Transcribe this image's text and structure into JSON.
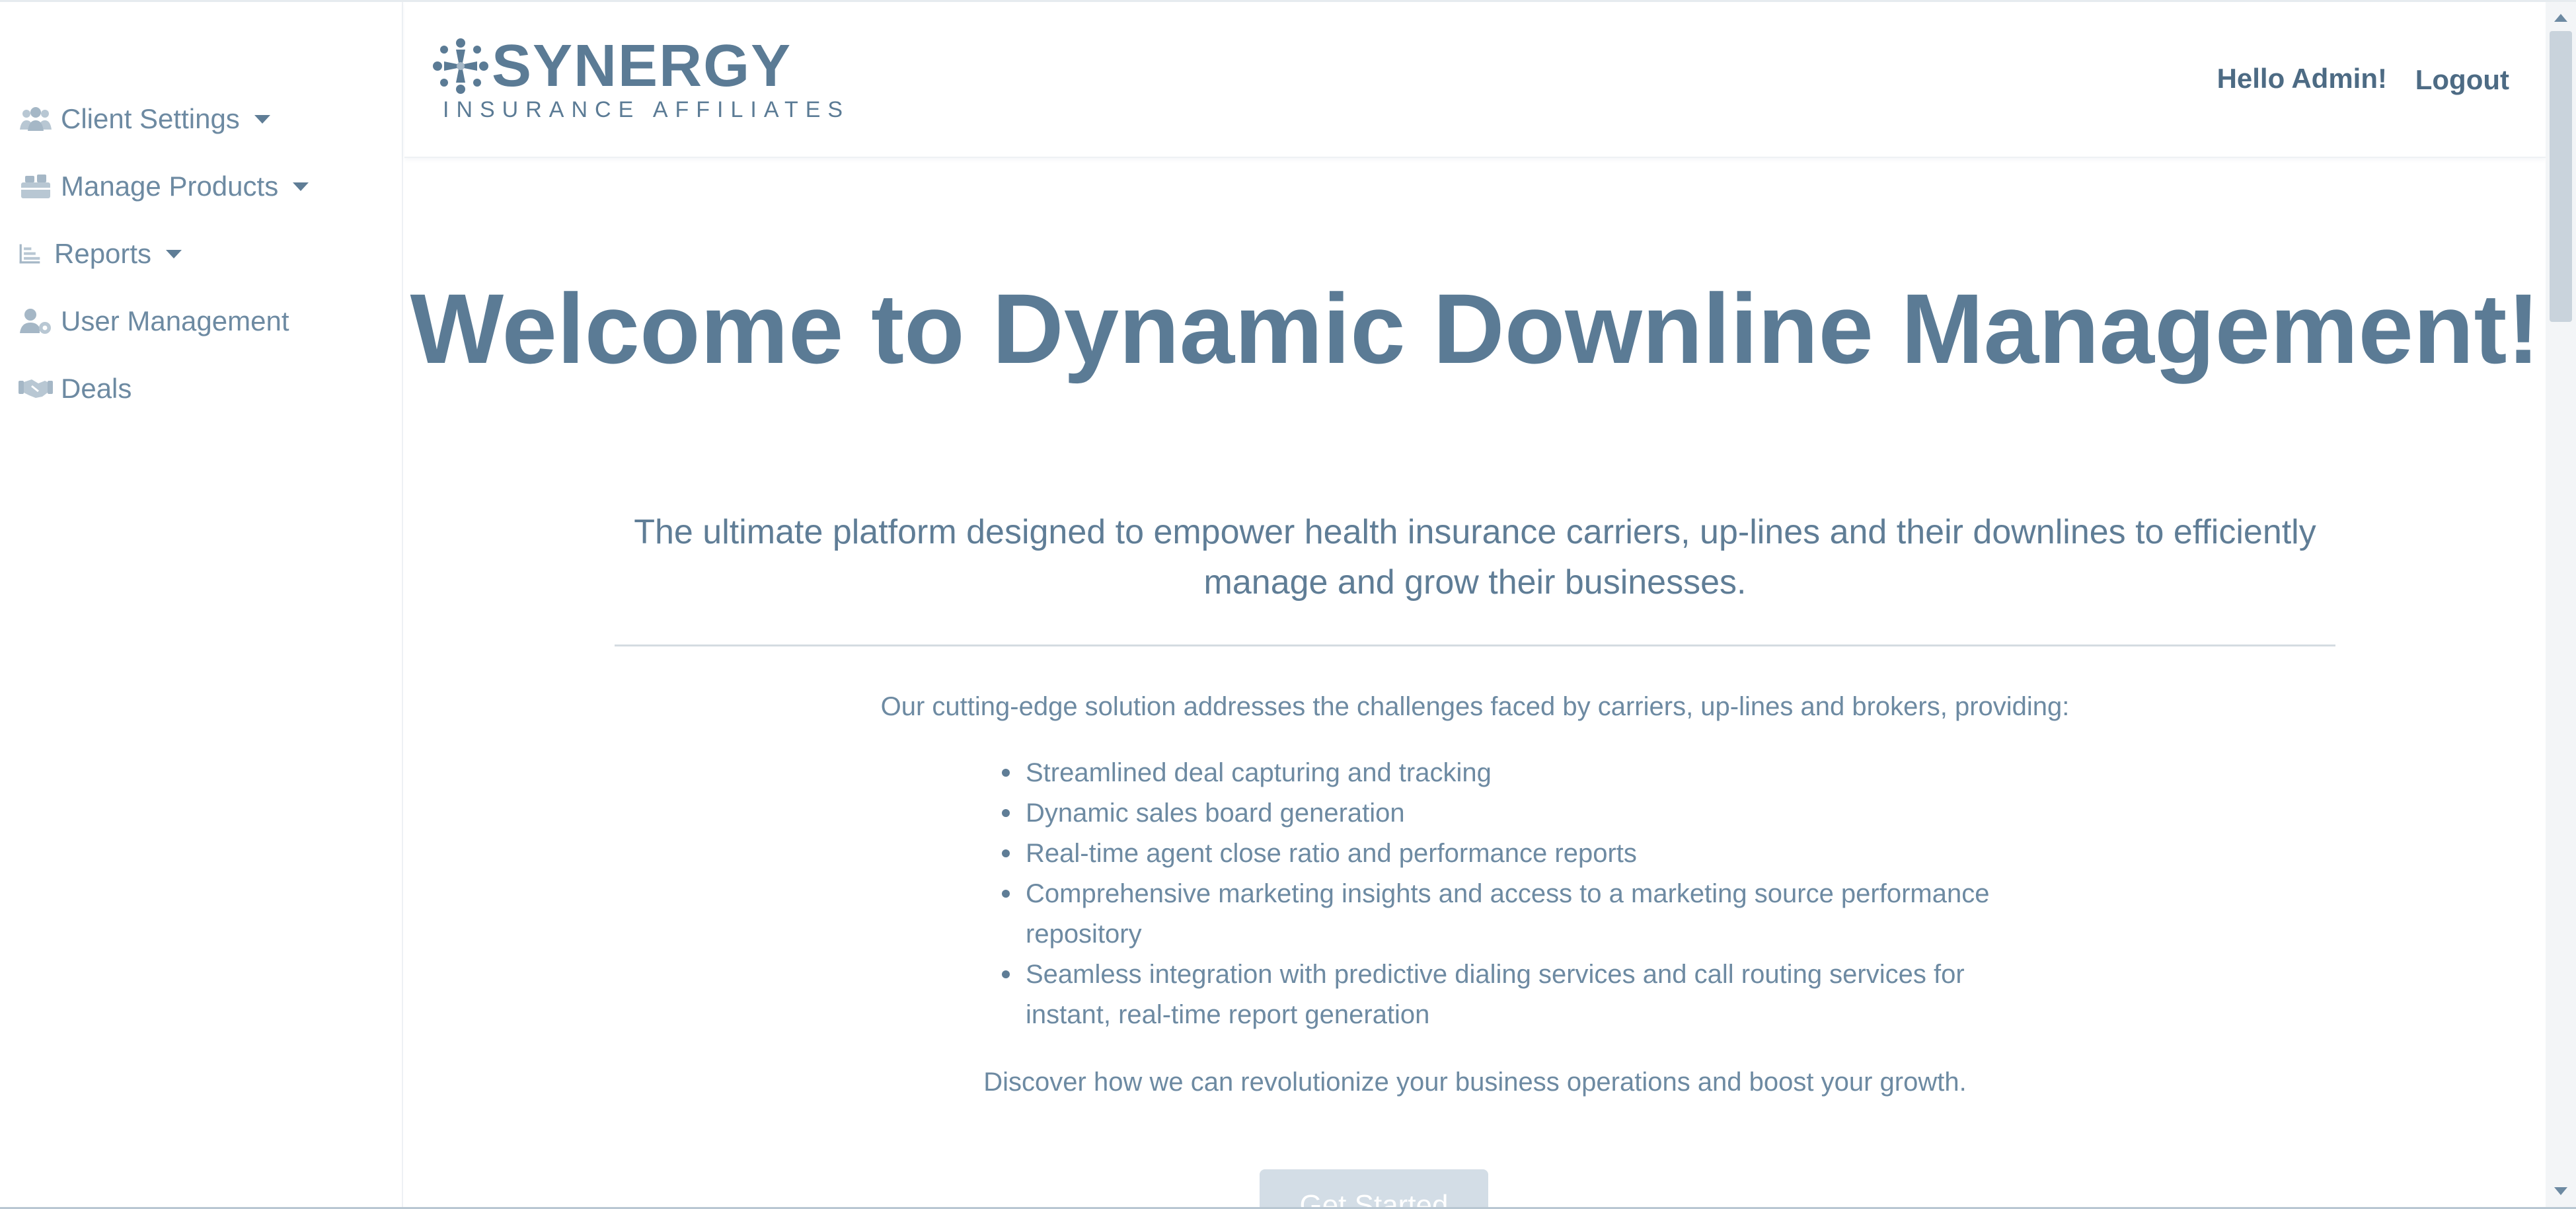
{
  "sidebar": {
    "items": [
      {
        "label": "Client Settings",
        "icon": "users-icon",
        "has_dropdown": true
      },
      {
        "label": "Manage Products",
        "icon": "boxes-icon",
        "has_dropdown": true
      },
      {
        "label": "Reports",
        "icon": "bar-chart-icon",
        "has_dropdown": true
      },
      {
        "label": "User Management",
        "icon": "user-gear-icon",
        "has_dropdown": false
      },
      {
        "label": "Deals",
        "icon": "handshake-icon",
        "has_dropdown": false
      }
    ]
  },
  "header": {
    "logo": {
      "name": "SYNERGY",
      "tagline": "INSURANCE AFFILIATES"
    },
    "greeting": "Hello Admin!",
    "logout_label": "Logout"
  },
  "main": {
    "title": "Welcome to Dynamic Downline Management!",
    "subtitle": "The ultimate platform designed to empower health insurance carriers, up-lines and their downlines to efficiently manage and grow their businesses.",
    "intro": "Our cutting-edge solution addresses the challenges faced by carriers, up-lines and brokers, providing:",
    "features": [
      "Streamlined deal capturing and tracking",
      "Dynamic sales board generation",
      "Real-time agent close ratio and performance reports",
      "Comprehensive marketing insights and access to a marketing source performance repository",
      "Seamless integration with predictive dialing services and call routing services for instant, real-time report generation"
    ],
    "closing": "Discover how we can revolutionize your business operations and boost your growth.",
    "cta_label": "Get Started"
  },
  "colors": {
    "brand": "#5b7b95",
    "text": "#6d8aa2",
    "cta_bg": "#d3dde6"
  }
}
